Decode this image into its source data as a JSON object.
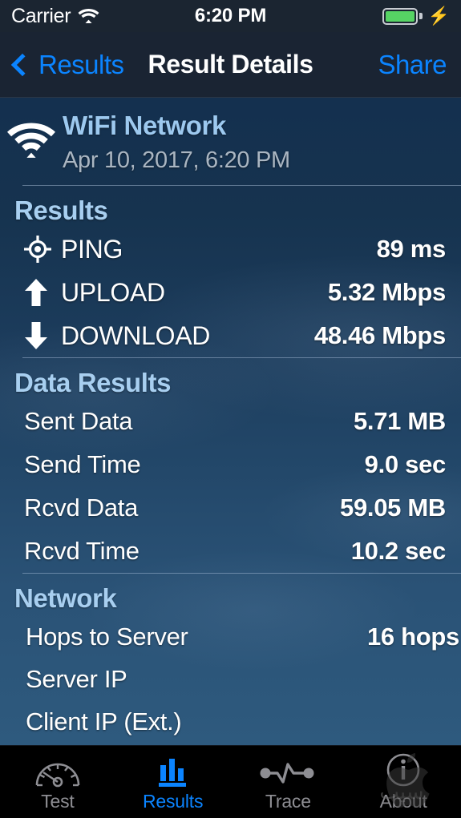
{
  "status_bar": {
    "carrier": "Carrier",
    "wifi_icon": "wifi-icon",
    "time": "6:20 PM",
    "battery_icon": "battery-full-icon",
    "charging_icon": "lightning-bolt-icon"
  },
  "nav_bar": {
    "back_label": "Results",
    "back_icon": "chevron-left-icon",
    "title": "Result Details",
    "action_label": "Share"
  },
  "header": {
    "icon": "wifi-icon",
    "title": "WiFi Network",
    "subtitle": "Apr 10, 2017, 6:20 PM"
  },
  "sections": [
    {
      "title": "Results",
      "rows": [
        {
          "icon": "crosshair-icon",
          "label": "PING",
          "value": "89 ms"
        },
        {
          "icon": "arrow-up-icon",
          "label": "UPLOAD",
          "value": "5.32 Mbps"
        },
        {
          "icon": "arrow-down-icon",
          "label": "DOWNLOAD",
          "value": "48.46 Mbps"
        }
      ]
    },
    {
      "title": "Data Results",
      "rows": [
        {
          "label": "Sent Data",
          "value": "5.71 MB"
        },
        {
          "label": "Send Time",
          "value": "9.0 sec"
        },
        {
          "label": "Rcvd Data",
          "value": "59.05 MB"
        },
        {
          "label": "Rcvd Time",
          "value": "10.2 sec"
        }
      ]
    },
    {
      "title": "Network",
      "rows": [
        {
          "label": "Hops to Server",
          "value": "16 hops"
        },
        {
          "label": "Server IP",
          "value": ""
        },
        {
          "label": "Client IP (Ext.)",
          "value": ""
        }
      ]
    }
  ],
  "tabs": [
    {
      "label": "Test",
      "icon": "speedometer-icon",
      "active": false
    },
    {
      "label": "Results",
      "icon": "bar-chart-icon",
      "active": true
    },
    {
      "label": "Trace",
      "icon": "pulse-line-icon",
      "active": false
    },
    {
      "label": "About",
      "icon": "info-circle-icon",
      "active": false
    }
  ],
  "watermark": {
    "icon": "apple-logo-watermark",
    "text": "سیب"
  },
  "colors": {
    "accent_blue": "#0b84ff",
    "section_heading": "#a8cff0",
    "header_title": "#9dc9ef",
    "battery_green": "#56d364",
    "navbar_bg": "#1a2433",
    "tabbar_bg": "#000000",
    "inactive_tab": "#8e8e93"
  }
}
